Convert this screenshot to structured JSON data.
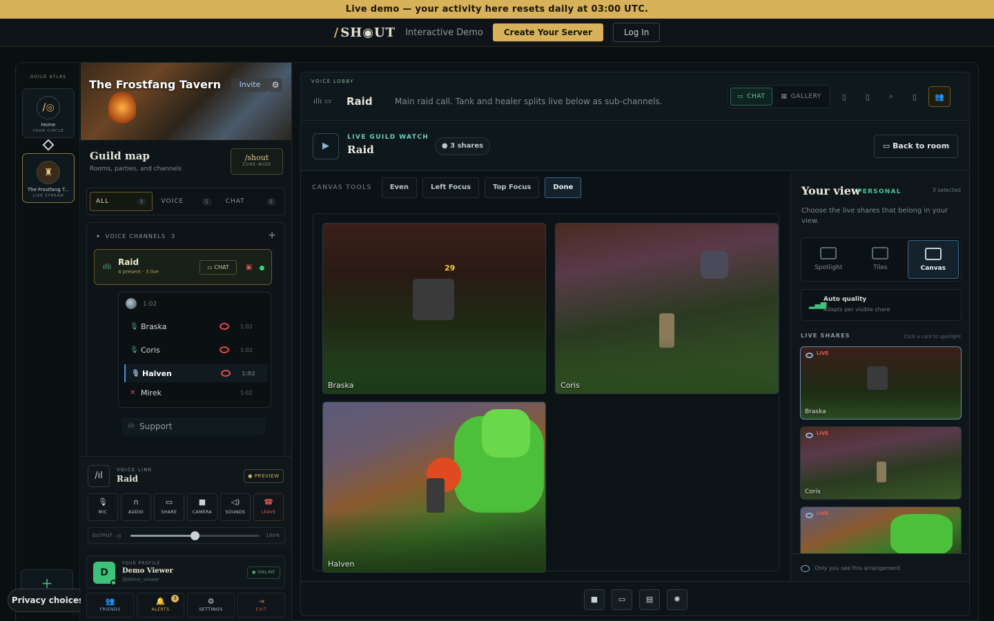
{
  "banner": {
    "text": "Live demo — your activity here resets daily at 03:00 UTC."
  },
  "topbar": {
    "logo_slash": "/",
    "logo": "SH◉UT",
    "subtitle": "Interactive Demo",
    "create_label": "Create Your Server",
    "login_label": "Log In"
  },
  "atlas": {
    "label": "GUILD ATLAS",
    "home": {
      "title": "Home",
      "sub": "YOUR CIRCLE"
    },
    "tavern": {
      "title": "The Frostfang T...",
      "sub": "LIVE STREAM"
    },
    "plus": "+"
  },
  "privacy": "Privacy choices",
  "guild": {
    "name": "The Frostfang Tavern",
    "invite": "Invite",
    "map_title": "Guild map",
    "map_sub": "Rooms, parties, and channels",
    "shout_title": "/shout",
    "shout_sub": "ZONE-WIDE",
    "filters": [
      {
        "label": "ALL",
        "count": "9"
      },
      {
        "label": "VOICE",
        "count": "5"
      },
      {
        "label": "CHAT",
        "count": "9"
      }
    ],
    "voice_header": "VOICE CHANNELS",
    "voice_count": "3",
    "raid": {
      "name": "Raid",
      "sub": "4 present · 3 live",
      "chat": "CHAT"
    },
    "timer": "1:02",
    "members": [
      {
        "name": "Braska",
        "time": "1:02"
      },
      {
        "name": "Coris",
        "time": "1:02"
      },
      {
        "name": "Halven",
        "time": "1:02"
      },
      {
        "name": "Mirek",
        "time": "1:02"
      }
    ],
    "support": "Support"
  },
  "voicelink": {
    "label": "VOICE LINK",
    "name": "Raid",
    "preview": "PREVIEW",
    "buttons": [
      "MIC",
      "AUDIO",
      "SHARE",
      "CAMERA",
      "SOUNDS",
      "LEAVE"
    ],
    "output_label": "OUTPUT",
    "output_value": "100%",
    "output_level": 0.5
  },
  "profile": {
    "label": "YOUR PROFILE",
    "name": "Demo Viewer",
    "handle": "@demo_viewer",
    "initial": "D",
    "status": "ONLINE"
  },
  "nav": [
    {
      "label": "FRIENDS"
    },
    {
      "label": "ALERTS",
      "badge": "3"
    },
    {
      "label": "SETTINGS"
    },
    {
      "label": "EXIT"
    }
  ],
  "main": {
    "lobby_label": "VOICE LOBBY",
    "room_name": "Raid",
    "room_desc": "Main raid call. Tank and healer splits live below as sub-channels.",
    "chat_tab": "CHAT",
    "gallery_tab": "GALLERY",
    "watch_label": "LIVE GUILD WATCH",
    "watch_name": "Raid",
    "shares": "3 shares",
    "back": "Back to room",
    "canvas_tools_label": "CANVAS TOOLS",
    "tools": [
      "Even",
      "Left Focus",
      "Top Focus",
      "Done"
    ],
    "tiles": [
      {
        "name": "Braska"
      },
      {
        "name": "Coris"
      },
      {
        "name": "Halven"
      }
    ],
    "damage": "29"
  },
  "view": {
    "title": "Your view",
    "tag": "PERSONAL",
    "selected": "3 selected",
    "desc": "Choose the live shares that belong in your view.",
    "modes": [
      "Spotlight",
      "Tiles",
      "Canvas"
    ],
    "auto_title": "Auto quality",
    "auto_sub": "Adapts per visible share",
    "live_label": "LIVE SHARES",
    "live_hint": "Click a card to spotlight",
    "live_tag": "LIVE",
    "shares": [
      {
        "name": "Braska"
      },
      {
        "name": "Coris"
      },
      {
        "name": ""
      }
    ],
    "footer": "Only you see this arrangement."
  }
}
